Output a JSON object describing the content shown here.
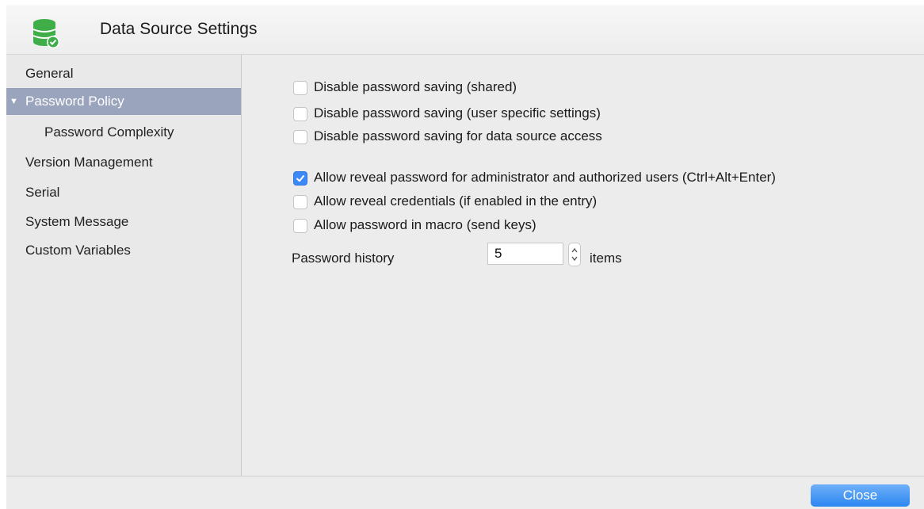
{
  "window": {
    "title": "Data Source Settings",
    "icon": "database-check-icon"
  },
  "sidebar": {
    "items": [
      {
        "label": "General",
        "selected": false
      },
      {
        "label": "Password Policy",
        "selected": true,
        "expanded": true
      },
      {
        "label": "Password Complexity",
        "selected": false,
        "child": true
      },
      {
        "label": "Version Management",
        "selected": false
      },
      {
        "label": "Serial",
        "selected": false
      },
      {
        "label": "System Message",
        "selected": false
      },
      {
        "label": "Custom Variables",
        "selected": false
      }
    ]
  },
  "options": [
    {
      "label": "Disable password saving (shared)",
      "checked": false
    },
    {
      "label": "Disable password saving (user specific settings)",
      "checked": false
    },
    {
      "label": "Disable password saving for data source access",
      "checked": false
    },
    {
      "label": "Allow reveal password for administrator and authorized users (Ctrl+Alt+Enter)",
      "checked": true
    },
    {
      "label": "Allow reveal credentials (if enabled in the entry)",
      "checked": false
    },
    {
      "label": "Allow password in macro (send keys)",
      "checked": false
    }
  ],
  "password_history": {
    "label": "Password history",
    "value": "5",
    "unit": "items"
  },
  "footer": {
    "close_label": "Close"
  },
  "colors": {
    "selection": "#9aa4bd",
    "accent": "#3c88f6",
    "icon_green": "#3fae49"
  }
}
